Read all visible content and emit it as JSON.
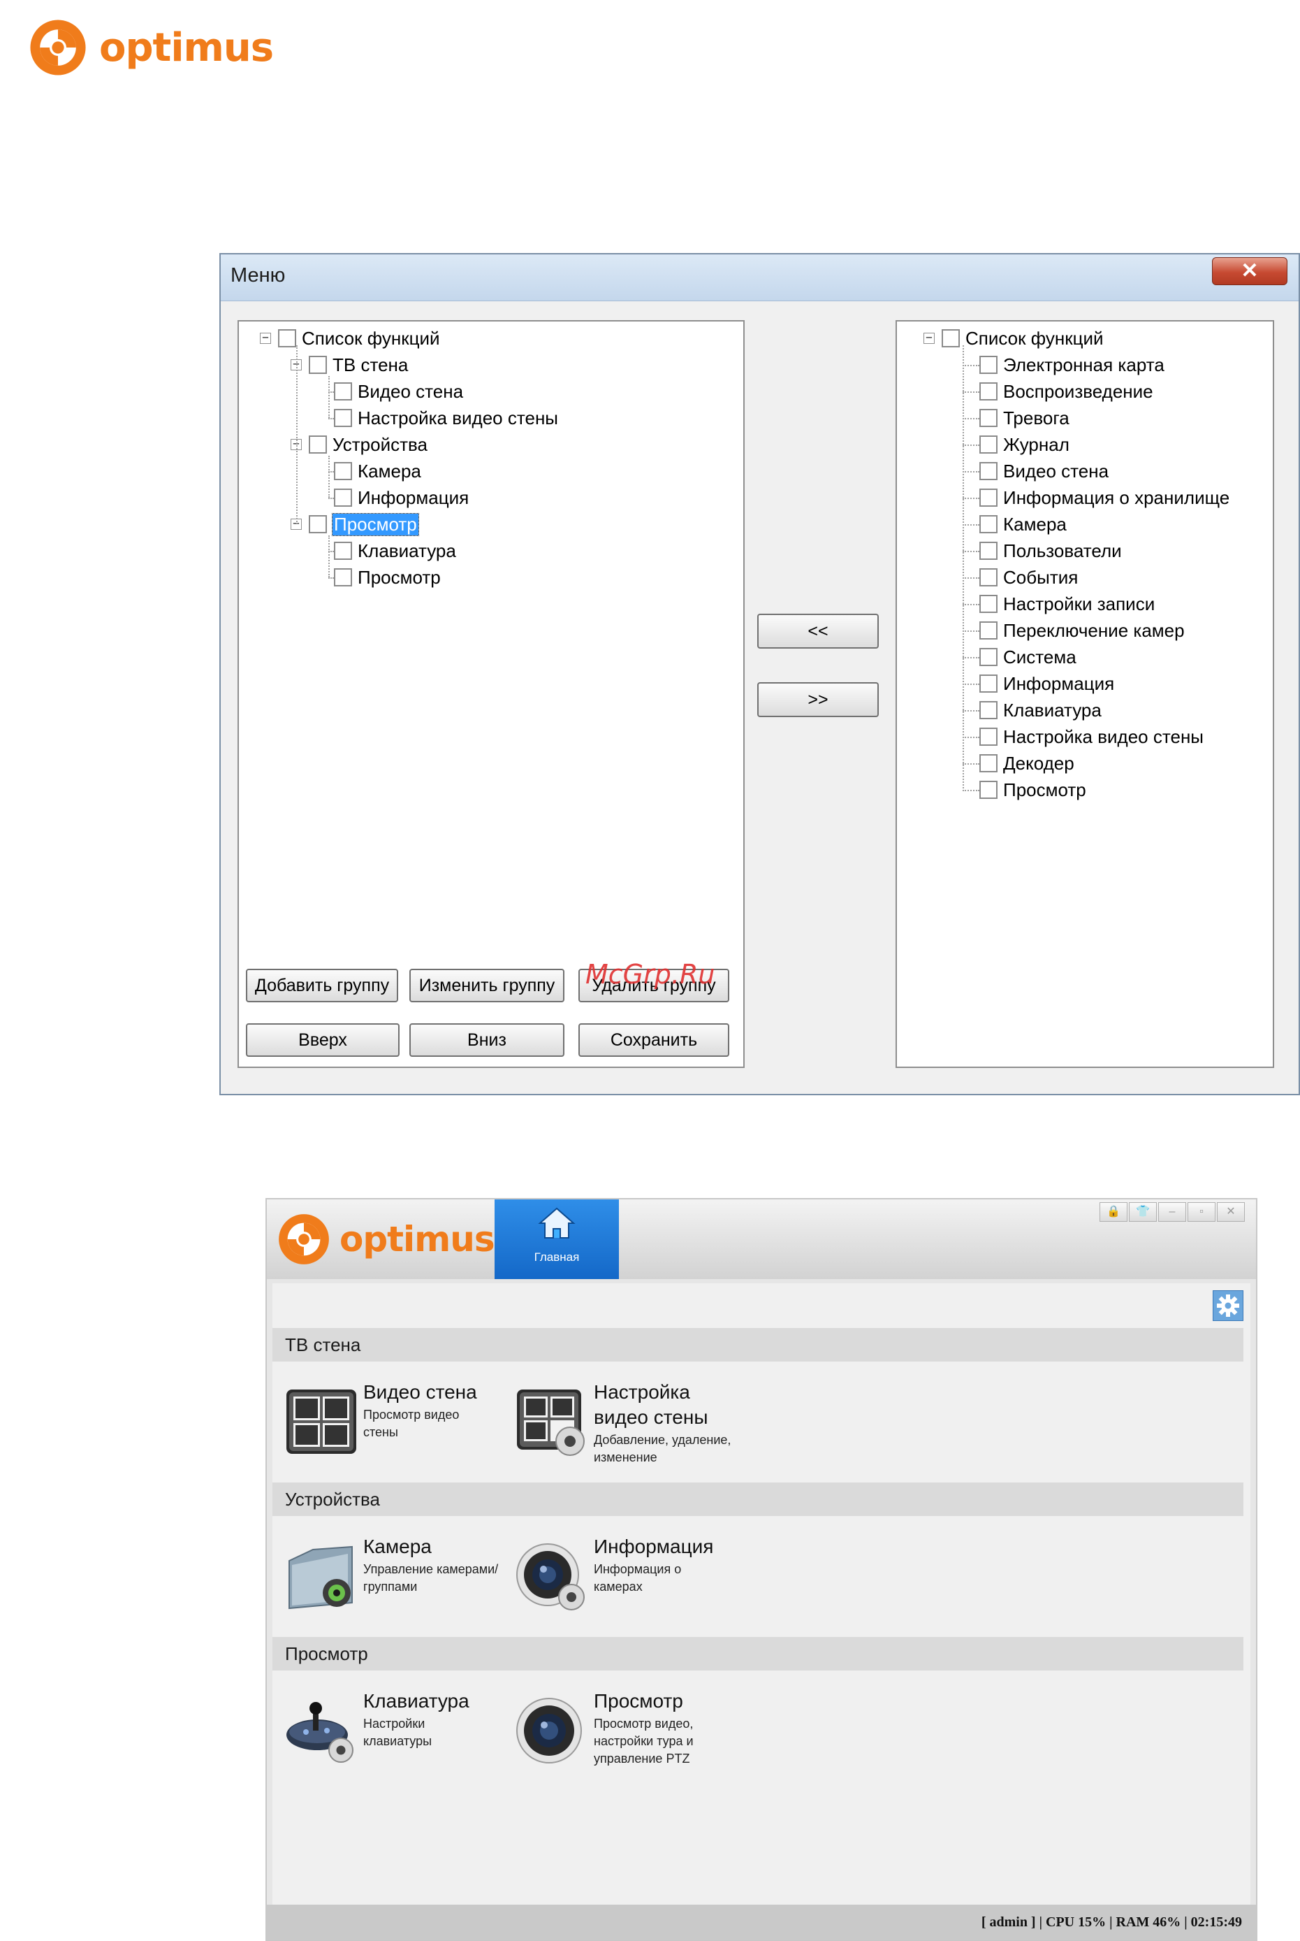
{
  "brand": {
    "name": "optimus",
    "color": "#f07c1b"
  },
  "dialog": {
    "title": "Меню",
    "close_label": "✕",
    "left_tree": {
      "root": "Список функций",
      "groups": [
        {
          "label": "ТВ стена",
          "children": [
            "Видео стена",
            "Настройка видео стены"
          ]
        },
        {
          "label": "Устройства",
          "children": [
            "Камера",
            "Информация"
          ]
        },
        {
          "label": "Просмотр",
          "children": [
            "Клавиатура",
            "Просмотр"
          ],
          "selected": true
        }
      ]
    },
    "right_tree": {
      "root": "Список функций",
      "items": [
        "Электронная карта",
        "Воспроизведение",
        "Тревога",
        "Журнал",
        "Видео стена",
        "Информация о хранилище",
        "Камера",
        "Пользователи",
        "События",
        "Настройки записи",
        "Переключение камер",
        "Система",
        "Информация",
        "Клавиатура",
        "Настройка видео стены",
        "Декодер",
        "Просмотр"
      ]
    },
    "buttons": {
      "move_left": "<<",
      "move_right": ">>",
      "add_group": "Добавить группу",
      "edit_group": "Изменить группу",
      "delete_group": "Удалить группу",
      "up": "Вверх",
      "down": "Вниз",
      "save": "Сохранить"
    },
    "watermark": "McGrp.Ru"
  },
  "app": {
    "home_tab_label": "Главная",
    "window_controls": [
      "🔒",
      "👕",
      "–",
      "▫",
      "✕"
    ],
    "sections": [
      {
        "title": "ТВ стена",
        "tiles": [
          {
            "title": "Видео стена",
            "desc": "Просмотр видео стены",
            "icon": "video-wall-icon"
          },
          {
            "title": "Настройка видео стены",
            "desc": "Добавление, удаление, изменение",
            "icon": "video-wall-settings-icon"
          }
        ]
      },
      {
        "title": "Устройства",
        "tiles": [
          {
            "title": "Камера",
            "desc": "Управление камерами/группами",
            "icon": "camera-folder-icon"
          },
          {
            "title": "Информация",
            "desc": "Информация о камерах",
            "icon": "camera-info-icon"
          }
        ]
      },
      {
        "title": "Просмотр",
        "tiles": [
          {
            "title": "Клавиатура",
            "desc": "Настройки клавиатуры",
            "icon": "keyboard-joystick-icon"
          },
          {
            "title": "Просмотр",
            "desc": "Просмотр видео, настройки тура и управление PTZ",
            "icon": "camera-lens-icon"
          }
        ]
      }
    ],
    "status_bar": "[ admin ] | CPU  15% | RAM  46% | 02:15:49"
  }
}
